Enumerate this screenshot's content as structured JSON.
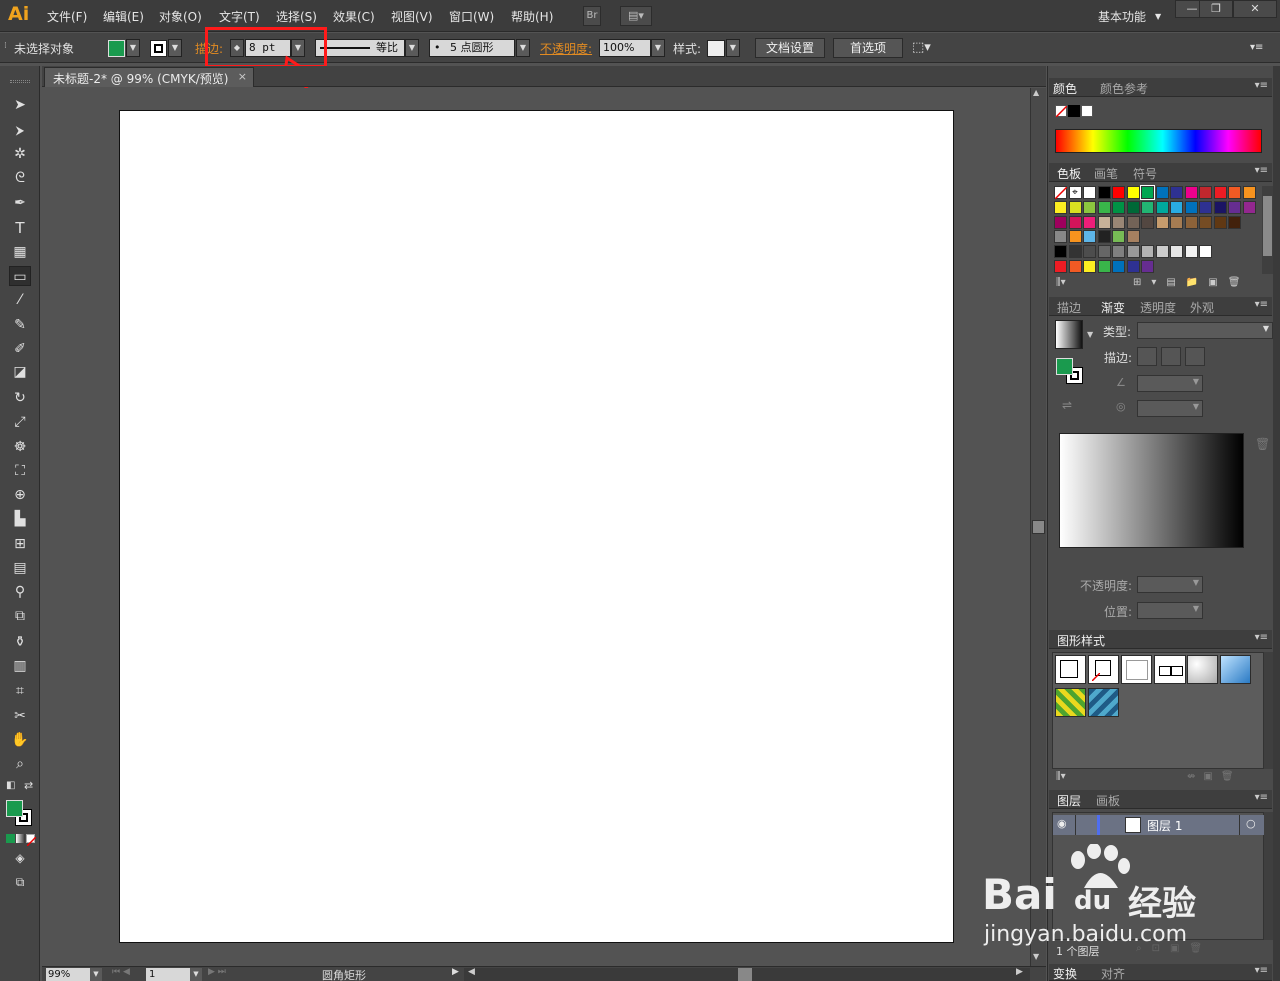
{
  "app": {
    "logo": "Ai",
    "workspace": "基本功能"
  },
  "menu": [
    "文件(F)",
    "编辑(E)",
    "对象(O)",
    "文字(T)",
    "选择(S)",
    "效果(C)",
    "视图(V)",
    "窗口(W)",
    "帮助(H)"
  ],
  "menubar_buttons": {
    "bridge": "Br",
    "arrange": "▤▾"
  },
  "window_controls": {
    "minimize": "—",
    "restore": "❐",
    "close": "✕"
  },
  "control": {
    "selection": "未选择对象",
    "stroke_label": "描边:",
    "stroke_value": "8 pt",
    "profile_label": "等比",
    "brush_label": "5 点圆形",
    "brush_dot": "•",
    "opacity_label": "不透明度:",
    "opacity_value": "100%",
    "style_label": "样式:",
    "doc_setup": "文档设置",
    "prefs": "首选项"
  },
  "colors": {
    "fill": "#1a9a4e",
    "accent_orange": "#e28b22",
    "highlight_red": "#ff1a1a"
  },
  "document": {
    "tab_title": "未标题-2* @ 99% (CMYK/预览)",
    "close": "×"
  },
  "status": {
    "zoom": "99%",
    "page": "1",
    "tool_name": "圆角矩形"
  },
  "tools": [
    "selection-icon",
    "direct-selection-icon",
    "magic-wand-icon",
    "lasso-icon",
    "pen-icon",
    "type-icon",
    "line-segment-icon",
    "rounded-rectangle-icon",
    "paintbrush-icon",
    "pencil-icon",
    "blob-brush-icon",
    "eraser-icon",
    "rotate-icon",
    "scale-icon",
    "warp-icon",
    "free-transform-icon",
    "shape-builder-icon",
    "perspective-grid-icon",
    "mesh-icon",
    "gradient-icon",
    "eyedropper-icon",
    "blend-icon",
    "symbol-sprayer-icon",
    "column-graph-icon",
    "artboard-icon",
    "slice-icon",
    "hand-icon",
    "zoom-icon"
  ],
  "panels": {
    "color": {
      "tabs": [
        "颜色",
        "颜色参考"
      ]
    },
    "swatches": {
      "tabs": [
        "色板",
        "画笔",
        "符号"
      ]
    },
    "gradient": {
      "tabs": [
        "描边",
        "渐变",
        "透明度",
        "外观"
      ],
      "type_label": "类型:",
      "stroke_label": "描边:",
      "opacity_label": "不透明度:",
      "position_label": "位置:"
    },
    "graphic_styles": {
      "tabs": [
        "图形样式"
      ]
    },
    "layers": {
      "tabs": [
        "图层",
        "画板"
      ],
      "layer_name": "图层 1",
      "count": "1 个图层"
    },
    "transform": {
      "tabs": [
        "变换",
        "对齐"
      ]
    }
  },
  "swatch_rows": [
    [
      "#ffffff",
      "#ffffff",
      "#ffffff",
      "#000000",
      "#ff0000",
      "#ffff00",
      "#00a651",
      "#0072bc",
      "#2e3192",
      "#ec008c",
      "#c1272d",
      "#ed1c24",
      "#f15a24",
      "#f7931e"
    ],
    [
      "#fcee21",
      "#d9e021",
      "#8cc63f",
      "#39b54a",
      "#009245",
      "#006837",
      "#22b573",
      "#00a99d",
      "#29abe2",
      "#0071bc",
      "#2e3192",
      "#1b1464",
      "#662d91",
      "#93278f"
    ],
    [
      "#9e005d",
      "#d4145a",
      "#ed1e79",
      "#c7b299",
      "#998675",
      "#736357",
      "#534741",
      "#c69c6d",
      "#a67c52",
      "#8c6239",
      "#754c24",
      "#603813",
      "#42210b"
    ],
    [
      "#888888",
      "#f7931e",
      "#5db5e8",
      "#222222",
      "#77bb55",
      "#a68060"
    ],
    [
      "#000000",
      "#333333",
      "#4d4d4d",
      "#666666",
      "#808080",
      "#999999",
      "#b3b3b3",
      "#cccccc",
      "#e6e6e6",
      "#f2f2f2",
      "#ffffff"
    ],
    [
      "#ed1c24",
      "#f15a24",
      "#fcee21",
      "#39b54a",
      "#0071bc",
      "#2e3192",
      "#662d91"
    ]
  ],
  "watermark": {
    "brand": "Bai",
    "brand2": "du",
    "brand_cn": "经验",
    "url": "jingyan.baidu.com"
  }
}
